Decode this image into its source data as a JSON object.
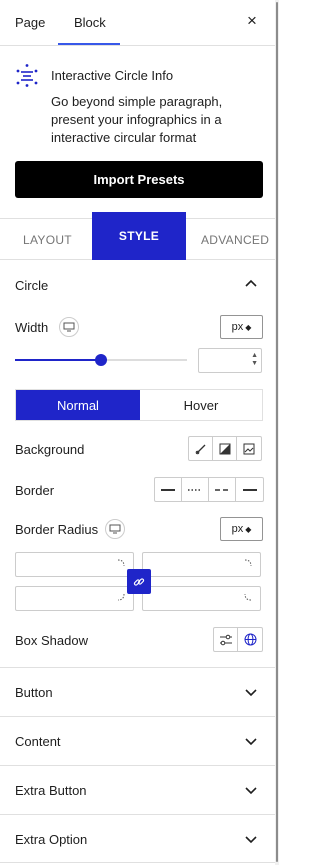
{
  "header": {
    "tab_page": "Page",
    "tab_block": "Block",
    "close_glyph": "×"
  },
  "block_info": {
    "title": "Interactive Circle Info",
    "description": "Go beyond simple paragraph, present your infographics in a interactive circular format"
  },
  "import_label": "Import Presets",
  "tabs": {
    "layout": "LAYOUT",
    "style": "STYLE",
    "advanced": "ADVANCED"
  },
  "circle": {
    "title": "Circle",
    "width_label": "Width",
    "width_unit": "px",
    "width_slider_fraction": 0.5,
    "width_value": "",
    "normal_label": "Normal",
    "hover_label": "Hover",
    "background_label": "Background",
    "border_label": "Border",
    "border_radius_label": "Border Radius",
    "border_radius_unit": "px",
    "box_shadow_label": "Box Shadow"
  },
  "collapsed_panels": [
    "Button",
    "Content",
    "Extra Button",
    "Extra Option"
  ],
  "colors": {
    "accent": "#1f25c9",
    "wp_blue": "#3858e9"
  }
}
